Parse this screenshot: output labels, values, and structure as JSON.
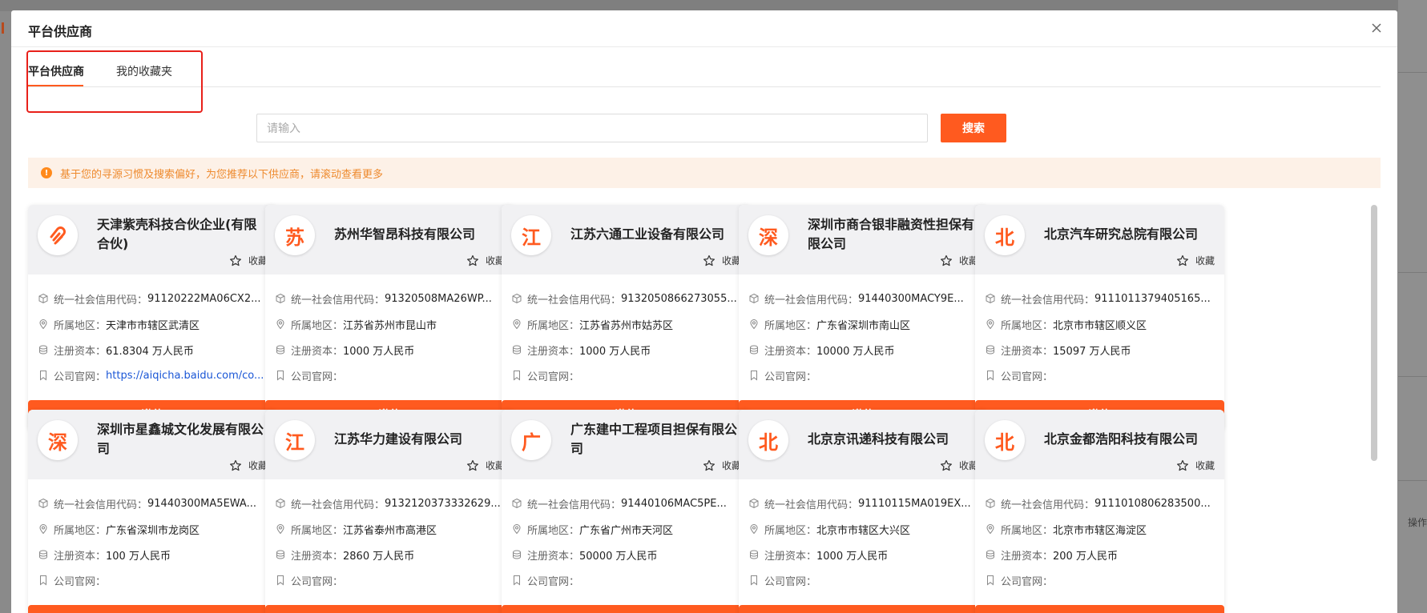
{
  "modal": {
    "title": "平台供应商",
    "close_icon": "close-icon"
  },
  "tabs": [
    {
      "label": "平台供应商",
      "active": true
    },
    {
      "label": "我的收藏夹",
      "active": false
    }
  ],
  "search": {
    "placeholder": "请输入",
    "value": "",
    "button_label": "搜索"
  },
  "notice": {
    "icon": "exclamation-icon",
    "text": "基于您的寻源习惯及搜索偏好，为您推荐以下供应商，请滚动查看更多"
  },
  "labels": {
    "credit_code": "统一社会信用代码：",
    "region": "所属地区：",
    "capital": "注册资本：",
    "website": "公司官网：",
    "favorite": "收藏",
    "invite": "邀约"
  },
  "colors": {
    "accent": "#ff5a1f",
    "link": "#1a56d6",
    "notice_bg": "#fdf1e7",
    "notice_text": "#ee8a2e"
  },
  "suppliers": [
    {
      "avatar": "logo",
      "name": "天津紫壳科技合伙企业(有限合伙)",
      "credit_code": "91120222MA06CX2...",
      "region": "天津市市辖区武清区",
      "capital": "61.8304 万人民币",
      "website": "https://aiqicha.baidu.com/co..."
    },
    {
      "avatar": "苏",
      "name": "苏州华智昂科技有限公司",
      "credit_code": "91320508MA26WP...",
      "region": "江苏省苏州市昆山市",
      "capital": "1000 万人民币",
      "website": ""
    },
    {
      "avatar": "江",
      "name": "江苏六通工业设备有限公司",
      "credit_code": "9132050866273055...",
      "region": "江苏省苏州市姑苏区",
      "capital": "1000 万人民币",
      "website": ""
    },
    {
      "avatar": "深",
      "name": "深圳市商合银非融资性担保有限公司",
      "credit_code": "91440300MACY9E...",
      "region": "广东省深圳市南山区",
      "capital": "10000 万人民币",
      "website": ""
    },
    {
      "avatar": "北",
      "name": "北京汽车研究总院有限公司",
      "credit_code": "9111011379405165...",
      "region": "北京市市辖区顺义区",
      "capital": "15097 万人民币",
      "website": ""
    },
    {
      "avatar": "深",
      "name": "深圳市星鑫城文化发展有限公司",
      "credit_code": "91440300MA5EWA...",
      "region": "广东省深圳市龙岗区",
      "capital": "100 万人民币",
      "website": ""
    },
    {
      "avatar": "江",
      "name": "江苏华力建设有限公司",
      "credit_code": "9132120373332629...",
      "region": "江苏省泰州市高港区",
      "capital": "2860 万人民币",
      "website": ""
    },
    {
      "avatar": "广",
      "name": "广东建中工程项目担保有限公司",
      "credit_code": "91440106MAC5PE...",
      "region": "广东省广州市天河区",
      "capital": "50000 万人民币",
      "website": ""
    },
    {
      "avatar": "北",
      "name": "北京京讯递科技有限公司",
      "credit_code": "91110115MA019EX...",
      "region": "北京市市辖区大兴区",
      "capital": "1000 万人民币",
      "website": ""
    },
    {
      "avatar": "北",
      "name": "北京金都浩阳科技有限公司",
      "credit_code": "9111010806283500...",
      "region": "北京市市辖区海淀区",
      "capital": "200 万人民币",
      "website": ""
    }
  ],
  "background": {
    "operation_label": "操作"
  }
}
